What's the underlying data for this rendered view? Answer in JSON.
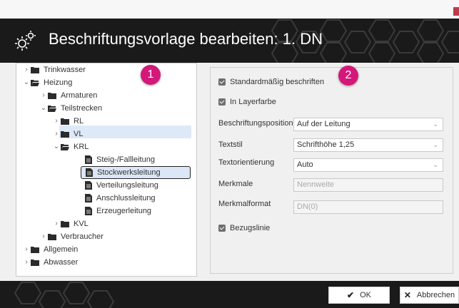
{
  "window": {
    "title": "Beschriftungsvorlage bearbeiten: 1. DN"
  },
  "badges": {
    "tree": "1",
    "props": "2"
  },
  "tree": {
    "items": [
      {
        "label": "Trinkwasser"
      },
      {
        "label": "Heizung"
      },
      {
        "label": "Armaturen"
      },
      {
        "label": "Teilstrecken"
      },
      {
        "label": "RL"
      },
      {
        "label": "VL"
      },
      {
        "label": "KRL"
      },
      {
        "label": "Steig-/Fallleitung"
      },
      {
        "label": "Stockwerksleitung"
      },
      {
        "label": "Verteilungsleitung"
      },
      {
        "label": "Anschlussleitung"
      },
      {
        "label": "Erzeugerleitung"
      },
      {
        "label": "KVL"
      },
      {
        "label": "Verbraucher"
      },
      {
        "label": "Allgemein"
      },
      {
        "label": "Abwasser"
      }
    ],
    "selected": "Stockwerksleitung"
  },
  "properties": {
    "standard_checkbox": "Standardmäßig beschriften",
    "layer_color_checkbox": "In Layerfarbe",
    "position_label": "Beschriftungsposition",
    "position_value": "Auf der Leitung",
    "textstyle_label": "Textstil",
    "textstyle_value": "Schrifthöhe 1,25",
    "orientation_label": "Textorientierung",
    "orientation_value": "Auto",
    "features_label": "Merkmale",
    "features_placeholder": "Nennweite",
    "feature_format_label": "Merkmalformat",
    "feature_format_placeholder": "DN(0)",
    "reference_line_checkbox": "Bezugslinie"
  },
  "footer": {
    "ok_label": "OK",
    "cancel_label": "Abbrechen"
  },
  "colors": {
    "header_bg": "#1a1a1a",
    "badge": "#d4187a",
    "selection": "#dbe7f6",
    "highlight": "#dde9f7"
  },
  "icons": [
    "gear-icon",
    "folder-icon",
    "folder-open-icon",
    "document-icon",
    "chevron-right-icon",
    "chevron-down-icon",
    "checkmark-icon",
    "close-icon"
  ]
}
